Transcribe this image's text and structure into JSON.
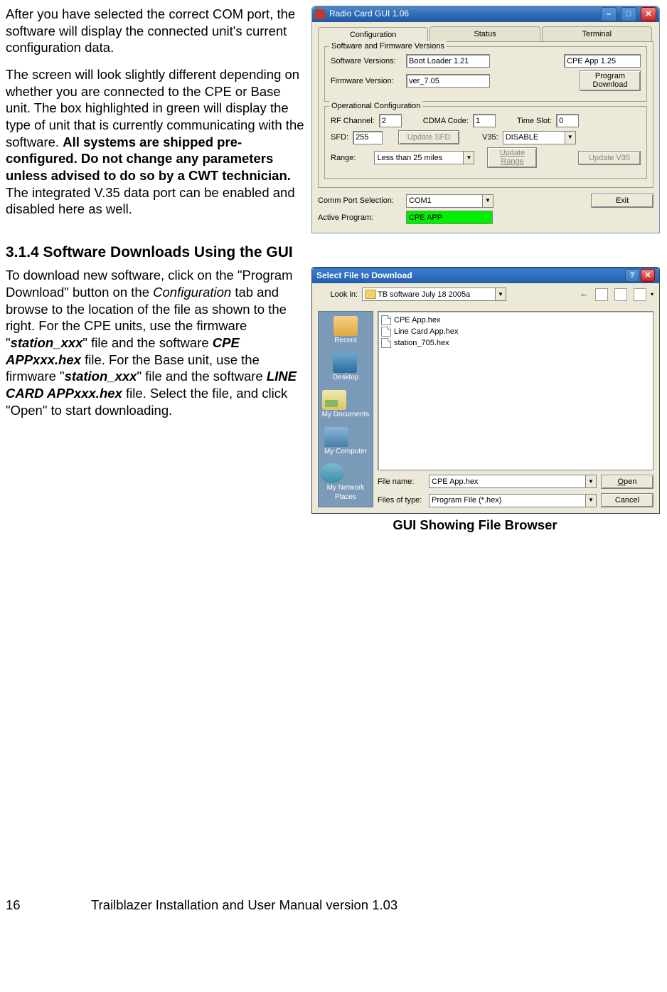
{
  "para1_a": "After you have selected the correct COM port, the software will display the connected unit's current configuration data.",
  "para1_b_pre": "The screen will look slightly different depending on whether you are connected to the CPE or Base unit. The box highlighted in green will display the type of unit that is currently communicating with the software. ",
  "para1_b_bold": "All systems are shipped pre-configured. Do not change any parameters unless advised to do so by a CWT technician.",
  "para1_b_post": " The integrated V.35 data port can be enabled and disabled here as well.",
  "heading": "3.1.4  Software Downloads Using the GUI",
  "para2_a": "To download new software, click on the \"Program Download\" button on the ",
  "para2_a_em": "Configuration",
  "para2_a2": " tab and browse to the location of the file as shown to the right. For the CPE units, use the firmware \"",
  "para2_b1": "station_xxx",
  "para2_a3": "\" file and the software ",
  "para2_b2": "CPE APPxxx.hex",
  "para2_a4": " file.  For the Base unit, use the firmware \"",
  "para2_b3": "station_xxx",
  "para2_a5": "\" file and the software ",
  "para2_b4": "LINE CARD APPxxx.hex",
  "para2_a6": " file. Select the file, and click \"Open\" to start downloading.",
  "caption": "GUI Showing File Browser",
  "page_number": "16",
  "footer_text": "Trailblazer Installation and User Manual version 1.03",
  "win1": {
    "title": "Radio Card GUI 1.06",
    "tabs": {
      "t1": "Configuration",
      "t2": "Status",
      "t3": "Terminal"
    },
    "fs1": {
      "legend": "Software and Firmware Versions",
      "l_sw": "Software Versions:",
      "v_sw1": "Boot Loader 1.21",
      "v_sw2": "CPE App 1.25",
      "l_fw": "Firmware Version:",
      "v_fw": "ver_7.05",
      "btn_prog1": "Program",
      "btn_prog2": "Download"
    },
    "fs2": {
      "legend": "Operational Configuration",
      "l_rf": "RF Channel:",
      "v_rf": "2",
      "l_cdma": "CDMA Code:",
      "v_cdma": "1",
      "l_ts": "Time Slot:",
      "v_ts": "0",
      "l_sfd": "SFD:",
      "v_sfd": "255",
      "btn_usfd": "Update SFD",
      "l_v35": "V35:",
      "v_v35": "DISABLE",
      "l_range": "Range:",
      "v_range": "Less than 25 miles",
      "btn_urange1": "Update",
      "btn_urange2": "Range",
      "btn_uv35": "Update V35"
    },
    "bottom": {
      "l_comm": "Comm Port Selection:",
      "v_comm": "COM1",
      "l_active": "Active Program:",
      "v_active": "CPE APP",
      "btn_exit": "Exit"
    }
  },
  "dlg": {
    "title": "Select File to Download",
    "l_lookin": "Look in:",
    "v_lookin": "TB software July 18 2005a",
    "places": {
      "recent": "Recent",
      "desktop": "Desktop",
      "docs": "My Documents",
      "comp": "My Computer",
      "net": "My Network Places"
    },
    "files": {
      "f1": "CPE App.hex",
      "f2": "Line Card App.hex",
      "f3": "station_705.hex"
    },
    "l_fname": "File name:",
    "v_fname": "CPE App.hex",
    "l_ftype": "Files of type:",
    "v_ftype": "Program File (*.hex)",
    "btn_open": "Open",
    "btn_cancel": "Cancel"
  }
}
